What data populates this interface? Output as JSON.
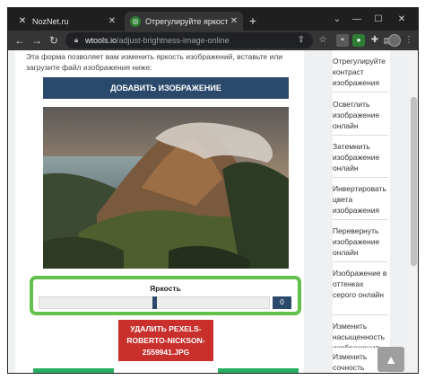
{
  "browser": {
    "tabs": [
      {
        "title": "NozNet.ru",
        "active": false,
        "icon": "nz-favicon"
      },
      {
        "title": "Отрегулируйте яркость изобра",
        "active": true,
        "icon": "wtools-favicon"
      }
    ],
    "new_tab_label": "+",
    "url_domain": "wtools.io",
    "url_path": "/adjust-brightness-image-online",
    "window_controls": [
      "chevron-down-icon",
      "minimize-icon",
      "maximize-icon",
      "close-icon"
    ]
  },
  "main": {
    "intro_text": "Эта форма позволяет вам изменить яркость изображений, вставьте или загрузите файл изображения ниже:",
    "add_button": "ДОБАВИТЬ ИЗОБРАЖЕНИЕ",
    "slider": {
      "label": "Яркость",
      "value": "0",
      "position_fraction": 0.5
    },
    "delete_button_lines": [
      "УДАЛИТЬ PEXELS-",
      "ROBERTO-NICKSON-",
      "2559941.JPG"
    ]
  },
  "sidebar": {
    "items": [
      "Отрегулируйте контраст изображения",
      "Осветлить изображение онлайн",
      "Затемнить изображение онлайн",
      "Инвертировать цвета изображения",
      "Перевернуть изображение онлайн",
      "Изображение в оттенках серого онлайн",
      "Изменить насыщенность изображения",
      "Изменить сочность изображения"
    ]
  },
  "colors": {
    "primary_button": "#2b4a6b",
    "danger_button": "#c9302c",
    "highlight_border": "#62c14a"
  }
}
